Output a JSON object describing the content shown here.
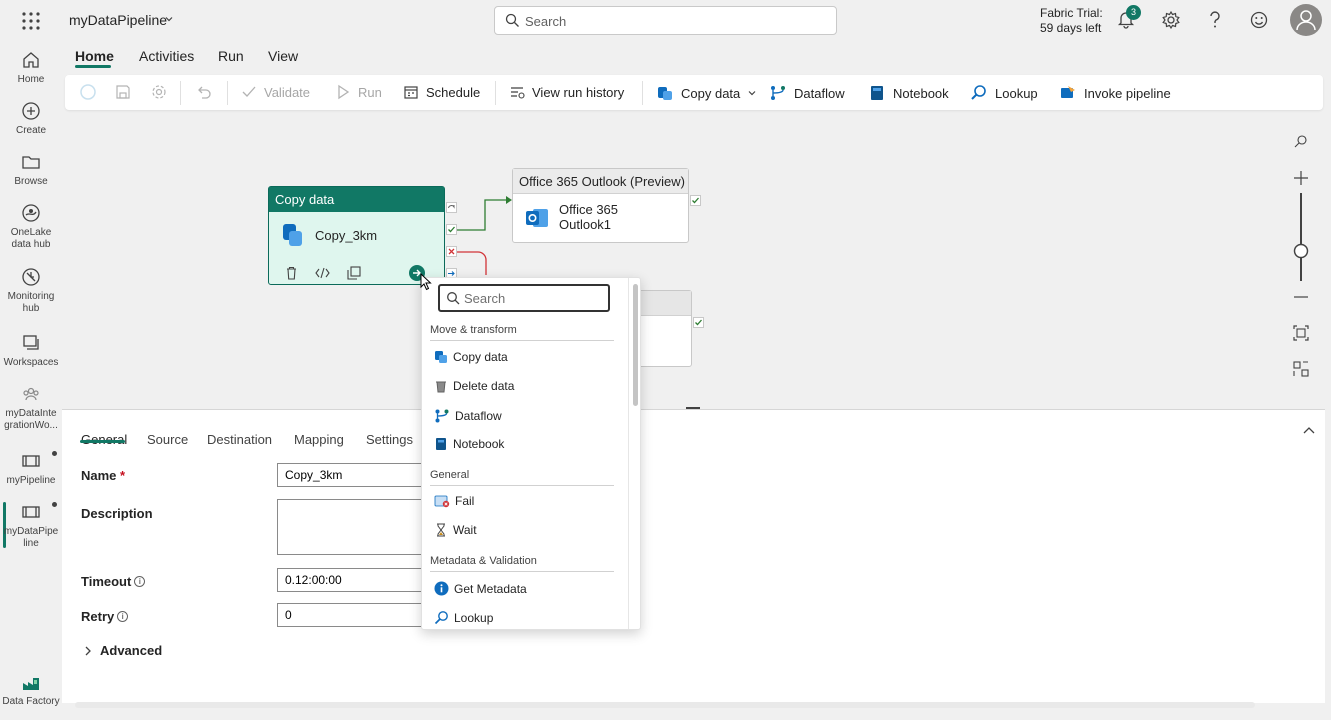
{
  "header": {
    "app_title": "myDataPipeline",
    "search_placeholder": "Search",
    "trial_line1": "Fabric Trial:",
    "trial_line2": "59 days left",
    "notification_count": "3"
  },
  "leftnav": {
    "items": [
      {
        "label": "Home"
      },
      {
        "label": "Create"
      },
      {
        "label": "Browse"
      },
      {
        "label1": "OneLake",
        "label2": "data hub"
      },
      {
        "label1": "Monitoring",
        "label2": "hub"
      },
      {
        "label": "Workspaces"
      },
      {
        "label1": "myDataInte",
        "label2": "grationWo..."
      },
      {
        "label": "myPipeline"
      },
      {
        "label1": "myDataPipe",
        "label2": "line"
      }
    ],
    "footer_label": "Data Factory"
  },
  "tabs": [
    "Home",
    "Activities",
    "Run",
    "View"
  ],
  "toolbar": {
    "validate": "Validate",
    "run": "Run",
    "schedule": "Schedule",
    "view_run_history": "View run history",
    "copy_data": "Copy data",
    "dataflow": "Dataflow",
    "notebook": "Notebook",
    "lookup": "Lookup",
    "invoke_pipeline": "Invoke pipeline"
  },
  "canvas": {
    "copy_node": {
      "header": "Copy data",
      "name": "Copy_3km"
    },
    "outlook_node": {
      "header": "Office 365 Outlook (Preview)",
      "name_line1": "Office 365",
      "name_line2": "Outlook1"
    }
  },
  "properties": {
    "tabs": [
      "General",
      "Source",
      "Destination",
      "Mapping",
      "Settings"
    ],
    "name_label": "Name",
    "required_mark": "*",
    "name_value": "Copy_3km",
    "description_label": "Description",
    "timeout_label": "Timeout",
    "timeout_value": "0.12:00:00",
    "retry_label": "Retry",
    "retry_value": "0",
    "advanced_label": "Advanced"
  },
  "picker": {
    "search_placeholder": "Search",
    "sections": [
      {
        "title": "Move & transform",
        "items": [
          "Copy data",
          "Delete data",
          "Dataflow",
          "Notebook"
        ]
      },
      {
        "title": "General",
        "items": [
          "Fail",
          "Wait"
        ]
      },
      {
        "title": "Metadata & Validation",
        "items": [
          "Get Metadata",
          "Lookup"
        ]
      }
    ]
  },
  "colors": {
    "accent": "#117865",
    "outlook_blue": "#0f6cbd"
  }
}
